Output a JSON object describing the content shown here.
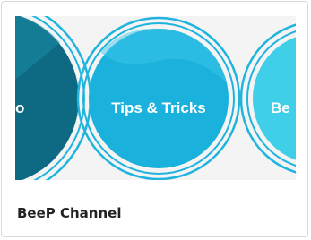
{
  "card": {
    "title": "BeeP Channel",
    "thumbnail": {
      "circles": [
        {
          "label": "o"
        },
        {
          "label": "Tips & Tricks"
        },
        {
          "label": "Be"
        }
      ]
    }
  },
  "colors": {
    "dark_circle": "#0e6a82",
    "main_circle": "#1ab1dc",
    "right_circle": "#3fcfe8",
    "ring": "#1fb4de",
    "text_on_circle": "#ffffff"
  }
}
